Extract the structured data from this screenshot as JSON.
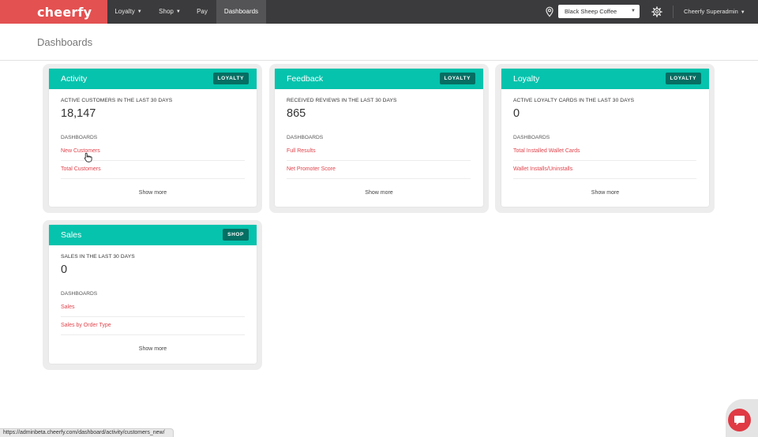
{
  "app": {
    "brand": "cheerfy",
    "colors": {
      "accent": "#e35151",
      "teal": "#05c3ad",
      "tag": "#066e63",
      "link": "#e0444c",
      "nav_bg": "#3b3b3d"
    }
  },
  "nav": {
    "items": [
      {
        "label": "Loyalty",
        "has_dropdown": true
      },
      {
        "label": "Shop",
        "has_dropdown": true
      },
      {
        "label": "Pay",
        "has_dropdown": false
      },
      {
        "label": "Dashboards",
        "has_dropdown": false,
        "active": true
      }
    ],
    "venue_select": {
      "value": "Black Sheep Coffee",
      "icon": "map-pin-icon"
    },
    "settings_icon": "gear-icon",
    "user": {
      "label": "Cheerfy Superadmin"
    }
  },
  "page": {
    "title": "Dashboards"
  },
  "cards": [
    {
      "title": "Activity",
      "tag": "LOYALTY",
      "metric_label": "ACTIVE CUSTOMERS IN THE LAST 30 DAYS",
      "metric_value": "18,147",
      "dashboards_label": "DASHBOARDS",
      "links": [
        "New Customers",
        "Total Customers"
      ],
      "show_more": "Show more"
    },
    {
      "title": "Feedback",
      "tag": "LOYALTY",
      "metric_label": "RECEIVED REVIEWS IN THE LAST 30 DAYS",
      "metric_value": "865",
      "dashboards_label": "DASHBOARDS",
      "links": [
        "Full Results",
        "Net Promoter Score"
      ],
      "show_more": "Show more"
    },
    {
      "title": "Loyalty",
      "tag": "LOYALTY",
      "metric_label": "ACTIVE LOYALTY CARDS IN THE LAST 30 DAYS",
      "metric_value": "0",
      "dashboards_label": "DASHBOARDS",
      "links": [
        "Total Installed Wallet Cards",
        "Wallet Installs/Uninstalls"
      ],
      "show_more": "Show more"
    },
    {
      "title": "Sales",
      "tag": "SHOP",
      "metric_label": "SALES IN THE LAST 30 DAYS",
      "metric_value": "0",
      "dashboards_label": "DASHBOARDS",
      "links": [
        "Sales",
        "Sales by Order Type"
      ],
      "show_more": "Show more"
    }
  ],
  "status_bar": {
    "url": "https://adminbeta.cheerfy.com/dashboard/activity/customers_new/"
  },
  "chat": {
    "icon": "chat-bubble-icon"
  }
}
